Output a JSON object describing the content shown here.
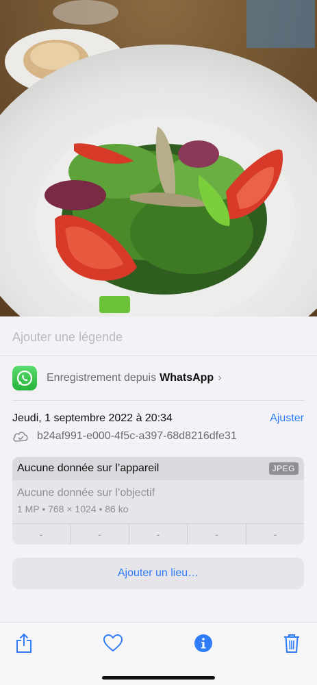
{
  "caption": {
    "placeholder": "Ajouter une légende"
  },
  "source": {
    "prefix": "Enregistrement depuis",
    "app": "WhatsApp",
    "chevron": "›",
    "icon": "whatsapp-icon"
  },
  "info": {
    "date": "Jeudi, 1 septembre 2022 à 20:34",
    "adjust_label": "Ajuster",
    "filename": "b24af991-e000-4f5c-a397-68d8216dfe31",
    "cloud_icon": "cloud-check-icon"
  },
  "metadata": {
    "device": "Aucune donnée sur l’appareil",
    "format": "JPEG",
    "lens": "Aucune donnée sur l’objectif",
    "specs": "1 MP • 768 × 1024 • 86 ko",
    "exif": [
      "-",
      "-",
      "-",
      "-",
      "-"
    ]
  },
  "location": {
    "add_label": "Ajouter un lieu…"
  },
  "toolbar": {
    "items": [
      "share-icon",
      "heart-icon",
      "info-icon",
      "trash-icon"
    ]
  },
  "colors": {
    "accent": "#2f7cf6",
    "whatsapp": "#25d366"
  }
}
